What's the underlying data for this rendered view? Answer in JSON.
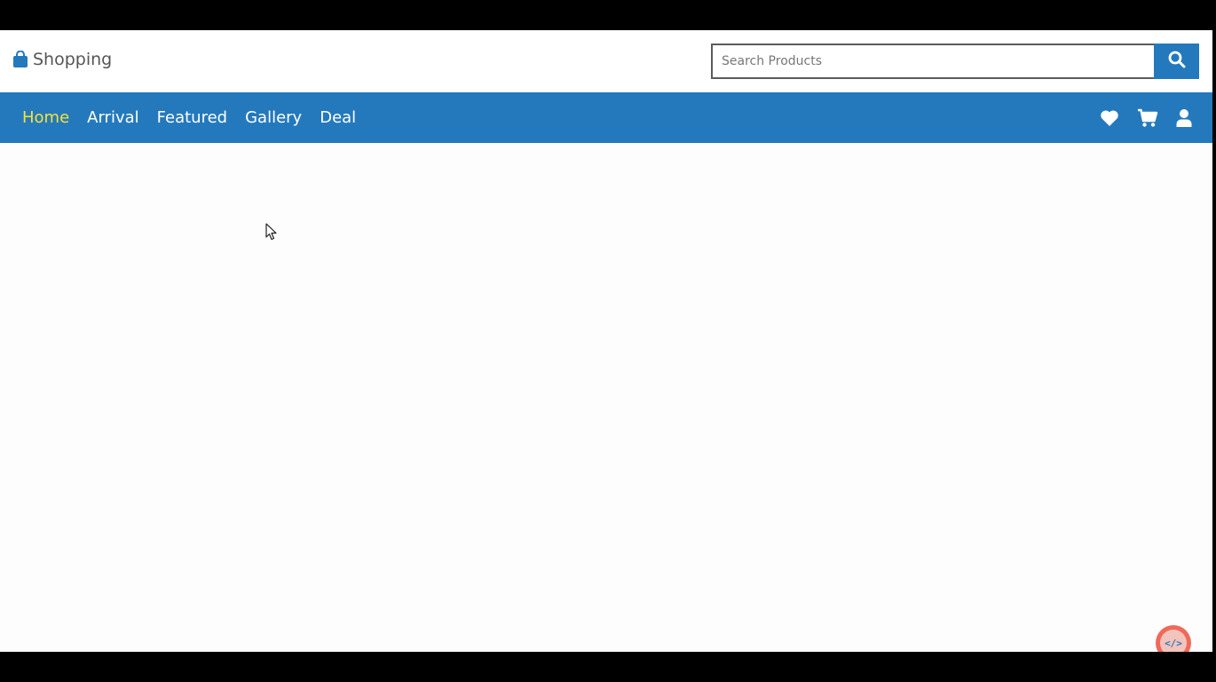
{
  "header": {
    "brand": {
      "icon": "shopping-bag-icon",
      "label": "Shopping"
    },
    "search": {
      "placeholder": "Search Products",
      "value": "",
      "button_icon": "search-icon"
    }
  },
  "nav": {
    "links": [
      {
        "label": "Home",
        "active": true
      },
      {
        "label": "Arrival",
        "active": false
      },
      {
        "label": "Featured",
        "active": false
      },
      {
        "label": "Gallery",
        "active": false
      },
      {
        "label": "Deal",
        "active": false
      }
    ],
    "icons": [
      "heart-icon",
      "cart-icon",
      "user-icon"
    ]
  },
  "floating_button": {
    "icon": "code-icon",
    "label": "</>"
  },
  "colors": {
    "brand_blue": "#2479bd",
    "active_link": "#f4e23b",
    "nav_text": "#ffffff",
    "fab": "#ef6a5b"
  }
}
